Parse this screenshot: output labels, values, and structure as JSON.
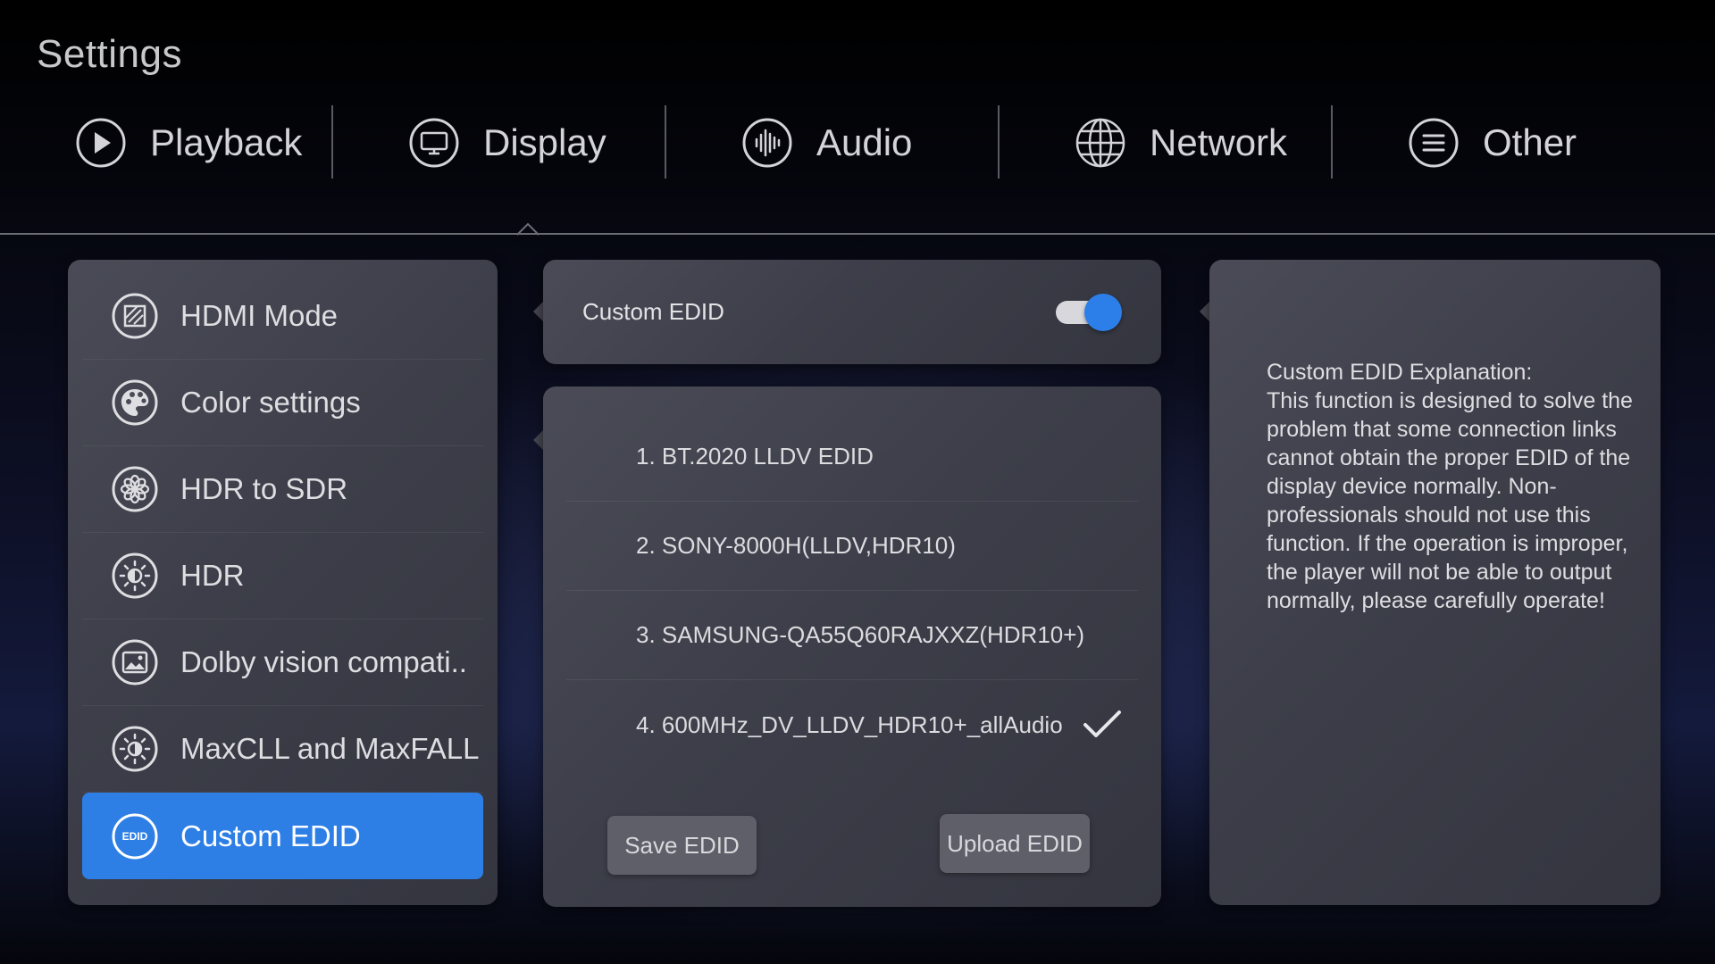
{
  "app": {
    "title": "Settings"
  },
  "tabs": [
    {
      "label": "Playback",
      "icon": "play-circle-icon"
    },
    {
      "label": "Display",
      "icon": "monitor-icon"
    },
    {
      "label": "Audio",
      "icon": "waveform-icon"
    },
    {
      "label": "Network",
      "icon": "globe-icon"
    },
    {
      "label": "Other",
      "icon": "menu-lines-icon"
    }
  ],
  "sidebar": {
    "items": [
      {
        "label": "HDMI Mode",
        "icon": "hdmi-mode-icon"
      },
      {
        "label": "Color settings",
        "icon": "palette-icon"
      },
      {
        "label": "HDR to SDR",
        "icon": "flower-icon"
      },
      {
        "label": "HDR",
        "icon": "sun-hdr-icon"
      },
      {
        "label": "Dolby vision compati..",
        "icon": "image-frame-icon"
      },
      {
        "label": "MaxCLL and MaxFALL",
        "icon": "brightness-icon"
      },
      {
        "label": "Custom EDID",
        "icon": "edid-icon",
        "icon_text": "EDID"
      }
    ],
    "active_index": 6
  },
  "custom_edid": {
    "label": "Custom EDID",
    "enabled": true
  },
  "edid_list": {
    "items": [
      "1. BT.2020 LLDV EDID",
      "2. SONY-8000H(LLDV,HDR10)",
      "3. SAMSUNG-QA55Q60RAJXXZ(HDR10+)",
      "4. 600MHz_DV_LLDV_HDR10+_allAudio"
    ],
    "selected_index": 3,
    "save_label": "Save EDID",
    "upload_label": "Upload EDID"
  },
  "info": {
    "text": "Custom EDID Explanation:\nThis function is designed to solve the problem that some connection links cannot obtain the proper EDID of the display device normally. Non-professionals should not use this function. If the operation is improper, the player will not be able to output normally, please carefully operate!"
  },
  "colors": {
    "accent": "#2d7fe6",
    "panel": "#42434d",
    "background": "#0b0d1e"
  }
}
